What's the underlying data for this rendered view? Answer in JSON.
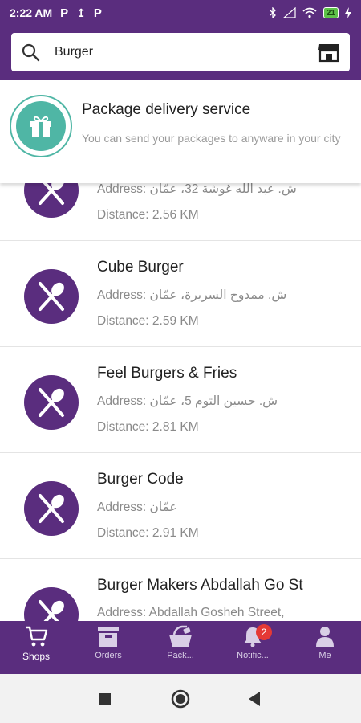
{
  "status_bar": {
    "time": "2:22 AM",
    "icons_left": [
      "P",
      "↥",
      "P"
    ],
    "battery": "21"
  },
  "search": {
    "value": "Burger",
    "placeholder": ""
  },
  "promo": {
    "title": "Package delivery service",
    "description": "You can send your packages to anyware in your city"
  },
  "shops": [
    {
      "name": "",
      "address": "Address: ش. عبد الله غوشة 32، عمّان",
      "distance": "Distance: 2.56 KM"
    },
    {
      "name": "Cube Burger",
      "address": "Address: ش. ممدوح السريرة، عمّان",
      "distance": "Distance: 2.59 KM"
    },
    {
      "name": "Feel Burgers & Fries",
      "address": "Address: ش. حسين التوم 5، عمّان",
      "distance": "Distance: 2.81 KM"
    },
    {
      "name": "Burger Code",
      "address": "Address: عمّان",
      "distance": "Distance: 2.91 KM"
    },
    {
      "name": "Burger Makers Abdallah Go St",
      "address": "Address: Abdallah Gosheh Street,",
      "distance": ""
    }
  ],
  "bottom_nav": [
    {
      "label": "Shops",
      "icon": "cart-icon",
      "active": true
    },
    {
      "label": "Orders",
      "icon": "box-icon"
    },
    {
      "label": "Pack...",
      "icon": "basket-icon"
    },
    {
      "label": "Notific...",
      "icon": "bell-icon",
      "badge": "2"
    },
    {
      "label": "Me",
      "icon": "person-icon"
    }
  ],
  "colors": {
    "primary": "#5a2d7e",
    "accent": "#4fb6a5",
    "badge": "#e53935"
  }
}
